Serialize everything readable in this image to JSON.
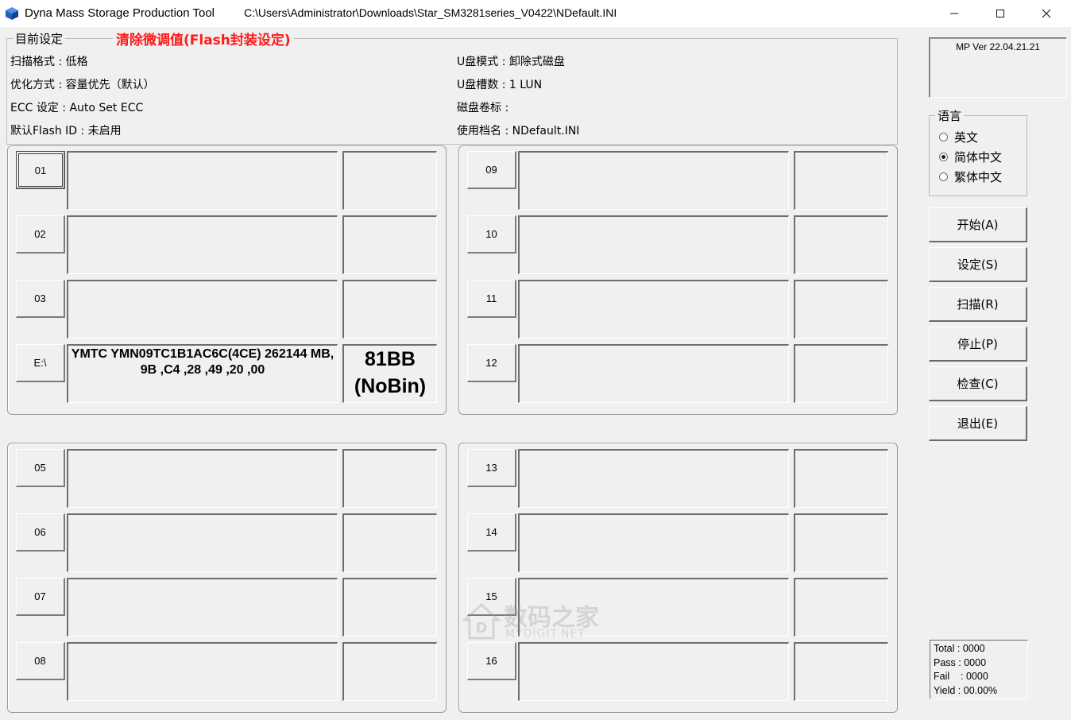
{
  "titlebar": {
    "app_name": "Dyna Mass Storage Production Tool",
    "file_path": "C:\\Users\\Administrator\\Downloads\\Star_SM3281series_V0422\\NDefault.INI"
  },
  "settings": {
    "legend": "目前设定",
    "warning": "清除微调值(Flash封装设定)",
    "left": [
      "扫描格式 : 低格",
      "优化方式 : 容量优先（默认）",
      "ECC 设定 : Auto Set ECC",
      "默认Flash ID : 未启用"
    ],
    "right": [
      "U盘模式 : 卸除式磁盘",
      "U盘槽数 : 1 LUN",
      "磁盘卷标 :",
      "使用档名 : NDefault.INI"
    ]
  },
  "ports": [
    {
      "label": "01",
      "info": "",
      "code": ""
    },
    {
      "label": "02",
      "info": "",
      "code": ""
    },
    {
      "label": "03",
      "info": "",
      "code": ""
    },
    {
      "label": "E:\\",
      "info": "YMTC YMN09TC1B1AC6C(4CE) 262144 MB, 9B ,C4 ,28 ,49 ,20 ,00",
      "code": "81BB (NoBin)"
    },
    {
      "label": "05",
      "info": "",
      "code": ""
    },
    {
      "label": "06",
      "info": "",
      "code": ""
    },
    {
      "label": "07",
      "info": "",
      "code": ""
    },
    {
      "label": "08",
      "info": "",
      "code": ""
    },
    {
      "label": "09",
      "info": "",
      "code": ""
    },
    {
      "label": "10",
      "info": "",
      "code": ""
    },
    {
      "label": "11",
      "info": "",
      "code": ""
    },
    {
      "label": "12",
      "info": "",
      "code": ""
    },
    {
      "label": "13",
      "info": "",
      "code": ""
    },
    {
      "label": "14",
      "info": "",
      "code": ""
    },
    {
      "label": "15",
      "info": "",
      "code": ""
    },
    {
      "label": "16",
      "info": "",
      "code": ""
    }
  ],
  "version": "MP Ver 22.04.21.21",
  "language": {
    "legend": "语言",
    "options": [
      "英文",
      "简体中文",
      "繁体中文"
    ],
    "selected": "简体中文"
  },
  "actions": [
    "开始(A)",
    "设定(S)",
    "扫描(R)",
    "停止(P)",
    "检查(C)",
    "退出(E)"
  ],
  "stats": [
    "Total : 0000",
    "Pass : 0000",
    "Fail    : 0000",
    "Yield : 00.00%"
  ],
  "watermark": {
    "cn": "数码之家",
    "en": "MYDIGIT.NET"
  },
  "colors": {
    "warning": "#ff1a1a",
    "window_bg": "#f0f0f0",
    "app_icon": "#1f5fbf"
  }
}
